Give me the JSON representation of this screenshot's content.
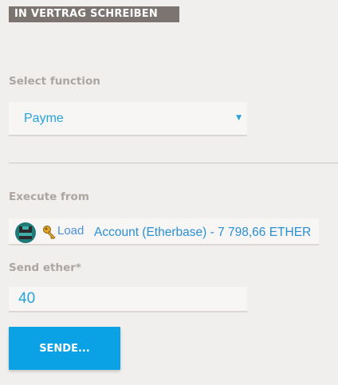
{
  "header": {
    "title": "IN VERTRAG SCHREIBEN"
  },
  "select_function": {
    "label": "Select function",
    "value": "Payme"
  },
  "execute_from": {
    "label": "Execute from",
    "load_label": "Load",
    "account_text": "Account (Etherbase) - 7 798,66 ETHER",
    "identicon": "identicon-avatar",
    "key_icon": "key-icon"
  },
  "send_ether": {
    "label": "Send ether*",
    "value": "40"
  },
  "actions": {
    "send_label": "SENDE..."
  },
  "colors": {
    "accent": "#26a3da",
    "button": "#0aa2e5",
    "header_bg": "#7b7471",
    "label": "#aca6a3",
    "page_bg": "#f0efee"
  }
}
